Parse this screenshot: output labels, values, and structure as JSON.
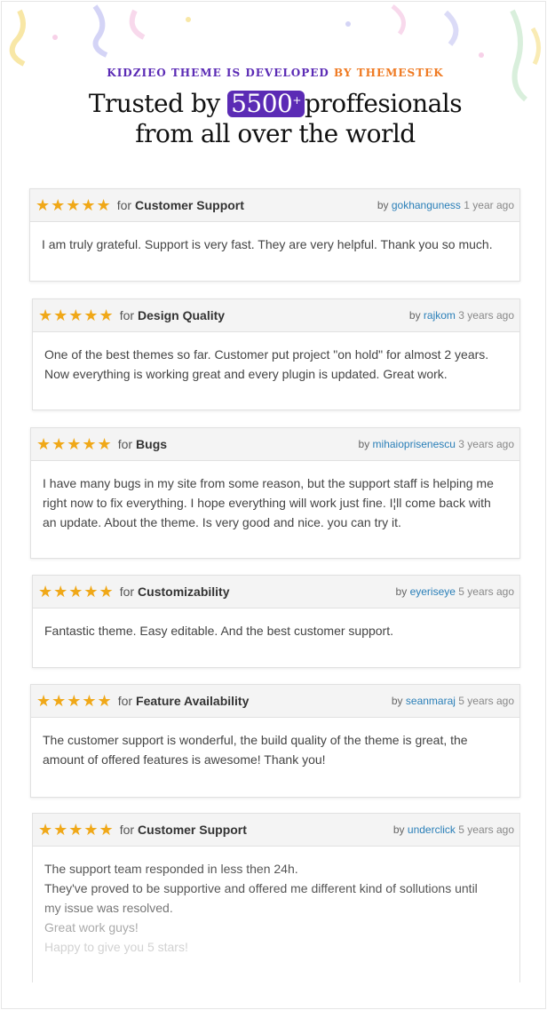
{
  "header": {
    "tagline_part1": "KIDZIEO THEME IS DEVELOPED",
    "tagline_part2": "BY THEMESTEK",
    "headline_pre": "Trusted by",
    "headline_number": "5500",
    "headline_plus": "+",
    "headline_post": "proffesionals",
    "headline_line2": "from all over the world"
  },
  "colors": {
    "brand_purple": "#5b2bb5",
    "brand_orange": "#ef7a22",
    "star_gold": "#f0a818",
    "link_blue": "#2a7fb8"
  },
  "reviews": [
    {
      "stars": "★★★★★",
      "for_label": "for",
      "category": "Customer Support",
      "by_label": "by",
      "author": "gokhanguness",
      "time": "1 year ago",
      "lines": [
        "I am truly grateful. Support is very fast. They are very helpful. Thank you so much."
      ]
    },
    {
      "stars": "★★★★★",
      "for_label": "for",
      "category": "Design Quality",
      "by_label": "by",
      "author": "rajkom",
      "time": "3 years ago",
      "lines": [
        "One of the best themes so far. Customer put project \"on hold\" for almost 2 years.",
        "Now everything is working great and every plugin is updated. Great work."
      ]
    },
    {
      "stars": "★★★★★",
      "for_label": "for",
      "category": "Bugs",
      "by_label": "by",
      "author": "mihaioprisenescu",
      "time": "3 years ago",
      "lines": [
        "I have many bugs in my site from some reason, but the support staff is helping me",
        "right now to fix everything. I hope everything will work just fine. I¦ll come back with",
        "an update. About the theme. Is very good and nice. you can try it."
      ]
    },
    {
      "stars": "★★★★★",
      "for_label": "for",
      "category": "Customizability",
      "by_label": "by",
      "author": "eyeriseye",
      "time": "5 years ago",
      "lines": [
        "Fantastic theme. Easy editable. And the best customer support."
      ]
    },
    {
      "stars": "★★★★★",
      "for_label": "for",
      "category": "Feature Availability",
      "by_label": "by",
      "author": "seanmaraj",
      "time": "5 years ago",
      "lines": [
        "The customer support is wonderful, the build quality of the theme is great, the",
        "amount of offered features is awesome! Thank you!"
      ]
    },
    {
      "stars": "★★★★★",
      "for_label": "for",
      "category": "Customer Support",
      "by_label": "by",
      "author": "underclick",
      "time": "5 years ago",
      "lines": [
        "The support team responded in less then 24h.",
        "They've proved to be supportive and offered me different kind of sollutions until",
        "my issue was resolved.",
        "Great work guys!",
        "Happy to give you 5 stars!"
      ]
    }
  ]
}
